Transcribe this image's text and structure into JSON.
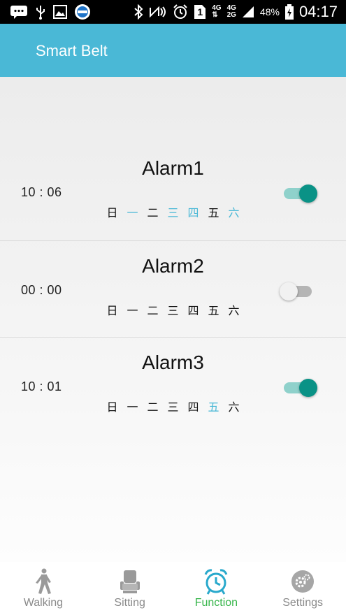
{
  "status_bar": {
    "network_1": "4G",
    "network_2": "4G",
    "network_3": "2G",
    "battery": "48%",
    "time": "04:17",
    "sim_number": "1",
    "icons": [
      "message-icon",
      "usb-icon",
      "image-icon",
      "ifly-icon",
      "bluetooth-icon",
      "nfc-icon",
      "alarm-icon",
      "sim-icon",
      "signal-icon",
      "battery-icon"
    ]
  },
  "app_bar": {
    "title": "Smart Belt"
  },
  "alarms": [
    {
      "name": "Alarm1",
      "time": "10 : 06",
      "enabled": true,
      "days": [
        {
          "label": "日",
          "on": false
        },
        {
          "label": "一",
          "on": true
        },
        {
          "label": "二",
          "on": false
        },
        {
          "label": "三",
          "on": true
        },
        {
          "label": "四",
          "on": true
        },
        {
          "label": "五",
          "on": false
        },
        {
          "label": "六",
          "on": true
        }
      ]
    },
    {
      "name": "Alarm2",
      "time": "00 : 00",
      "enabled": false,
      "days": [
        {
          "label": "日",
          "on": false
        },
        {
          "label": "一",
          "on": false
        },
        {
          "label": "二",
          "on": false
        },
        {
          "label": "三",
          "on": false
        },
        {
          "label": "四",
          "on": false
        },
        {
          "label": "五",
          "on": false
        },
        {
          "label": "六",
          "on": false
        }
      ]
    },
    {
      "name": "Alarm3",
      "time": "10 : 01",
      "enabled": true,
      "days": [
        {
          "label": "日",
          "on": false
        },
        {
          "label": "一",
          "on": false
        },
        {
          "label": "二",
          "on": false
        },
        {
          "label": "三",
          "on": false
        },
        {
          "label": "四",
          "on": false
        },
        {
          "label": "五",
          "on": true
        },
        {
          "label": "六",
          "on": false
        }
      ]
    }
  ],
  "bottom_nav": {
    "tabs": [
      {
        "label": "Walking",
        "icon": "walking-icon",
        "active": false
      },
      {
        "label": "Sitting",
        "icon": "chair-icon",
        "active": false
      },
      {
        "label": "Function",
        "icon": "alarm-clock-icon",
        "active": true
      },
      {
        "label": "Settings",
        "icon": "gear-icon",
        "active": false
      }
    ]
  },
  "colors": {
    "accent": "#4ab8d6",
    "toggle_on": "#0a9286",
    "active_tab": "#36b54a"
  }
}
